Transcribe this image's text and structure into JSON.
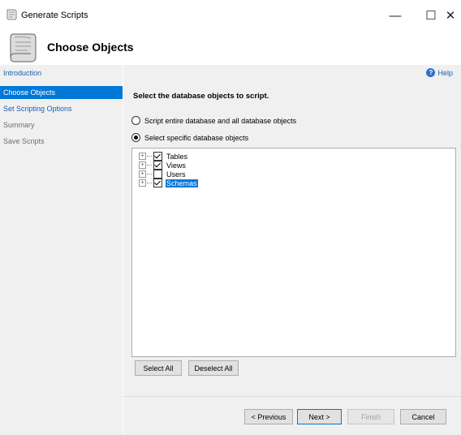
{
  "window": {
    "title": "Generate Scripts",
    "controls": {
      "minimize": "—",
      "maximize": "☐",
      "close": "✕"
    }
  },
  "header": {
    "title": "Choose Objects",
    "icon": "scroll-icon"
  },
  "sidebar": {
    "items": [
      {
        "label": "Introduction",
        "state": "link"
      },
      {
        "label": "Choose Objects",
        "state": "active"
      },
      {
        "label": "Set Scripting Options",
        "state": "link"
      },
      {
        "label": "Summary",
        "state": "disabled"
      },
      {
        "label": "Save Scripts",
        "state": "disabled"
      }
    ]
  },
  "main": {
    "help_label": "Help",
    "instruction": "Select the database objects to script.",
    "options": [
      {
        "label": "Script entire database and all database objects",
        "checked": false
      },
      {
        "label": "Select specific database objects",
        "checked": true
      }
    ],
    "tree": [
      {
        "label": "Tables",
        "checked": true,
        "selected": false
      },
      {
        "label": "Views",
        "checked": true,
        "selected": false
      },
      {
        "label": "Users",
        "checked": false,
        "selected": false
      },
      {
        "label": "Schemas",
        "checked": true,
        "selected": true
      }
    ],
    "select_all_label": "Select All",
    "deselect_all_label": "Deselect All"
  },
  "footer": {
    "previous_label": "< Previous",
    "next_label": "Next >",
    "finish_label": "Finish",
    "cancel_label": "Cancel"
  },
  "colors": {
    "accent": "#0078d7",
    "link": "#1a5fb4",
    "panel": "#f0f0f0"
  }
}
